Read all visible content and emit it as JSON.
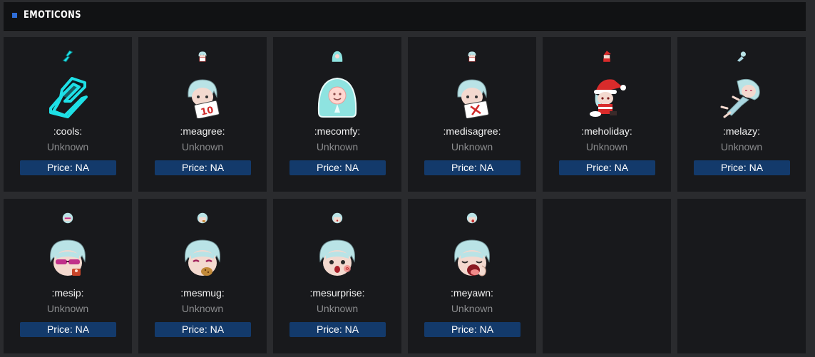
{
  "header": {
    "title": "EMOTICONS"
  },
  "emotes": [
    {
      "name": ":cools:",
      "rarity": "Unknown",
      "price": "Price: NA",
      "icon": "cools-icon",
      "kind": "cools"
    },
    {
      "name": ":meagree:",
      "rarity": "Unknown",
      "price": "Price: NA",
      "icon": "meagree-icon",
      "kind": "sign10"
    },
    {
      "name": ":mecomfy:",
      "rarity": "Unknown",
      "price": "Price: NA",
      "icon": "mecomfy-icon",
      "kind": "blob"
    },
    {
      "name": ":medisagree:",
      "rarity": "Unknown",
      "price": "Price: NA",
      "icon": "medisagree-icon",
      "kind": "signx"
    },
    {
      "name": ":meholiday:",
      "rarity": "Unknown",
      "price": "Price: NA",
      "icon": "meholiday-icon",
      "kind": "santa"
    },
    {
      "name": ":melazy:",
      "rarity": "Unknown",
      "price": "Price: NA",
      "icon": "melazy-icon",
      "kind": "lazy"
    },
    {
      "name": ":mesip:",
      "rarity": "Unknown",
      "price": "Price: NA",
      "icon": "mesip-icon",
      "kind": "sip"
    },
    {
      "name": ":mesmug:",
      "rarity": "Unknown",
      "price": "Price: NA",
      "icon": "mesmug-icon",
      "kind": "smug"
    },
    {
      "name": ":mesurprise:",
      "rarity": "Unknown",
      "price": "Price: NA",
      "icon": "mesurprise-icon",
      "kind": "surprise"
    },
    {
      "name": ":meyawn:",
      "rarity": "Unknown",
      "price": "Price: NA",
      "icon": "meyawn-icon",
      "kind": "yawn"
    }
  ],
  "colors": {
    "accent": "#2f6ed9",
    "price_button": "#133a6b",
    "card_bg": "#18191c",
    "cools_cyan": "#1ee0e6",
    "hair": "#b9e3e6"
  }
}
